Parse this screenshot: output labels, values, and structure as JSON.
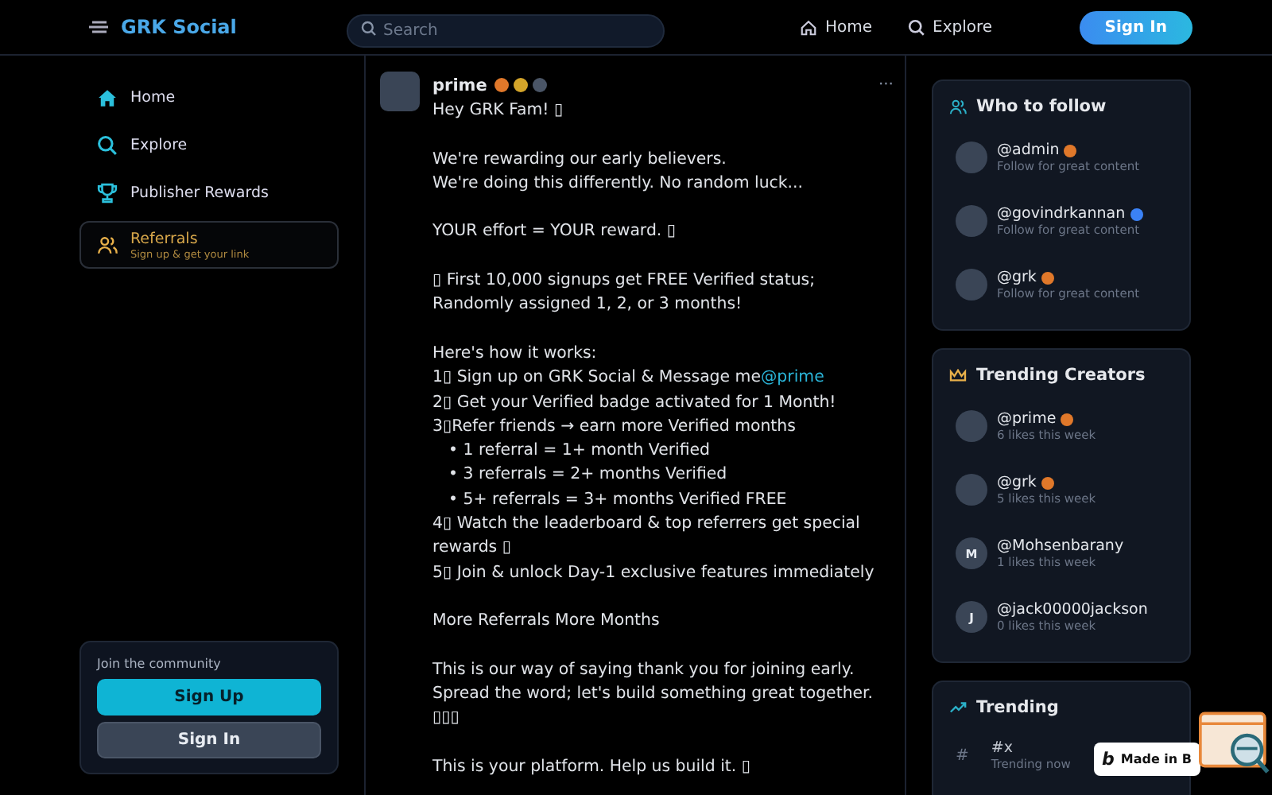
{
  "header": {
    "brand": "GRK Social",
    "search": {
      "placeholder": "Search"
    },
    "nav": [
      {
        "label": "Home"
      },
      {
        "label": "Explore"
      }
    ],
    "sign_in": "Sign In"
  },
  "sidebar": {
    "items": [
      {
        "label": "Home",
        "selected": false
      },
      {
        "label": "Explore",
        "selected": false
      },
      {
        "label": "Publisher Rewards",
        "selected": false
      },
      {
        "label": "Referrals",
        "sublabel": "Sign up & get your link",
        "selected": true
      }
    ],
    "community": {
      "label": "Join the community",
      "sign_up": "Sign Up",
      "sign_in": "Sign In"
    }
  },
  "post": {
    "author": "prime",
    "badges": [
      {
        "color": "#e0782a"
      },
      {
        "color": "#d4a52a"
      },
      {
        "color": "#4a5566"
      }
    ],
    "menu": "···",
    "paragraphs": [
      [
        {
          "kind": "text",
          "text": "Hey GRK Fam! ▯"
        }
      ],
      [
        {
          "kind": "text",
          "text": "We're rewarding our early believers."
        },
        {
          "kind": "text",
          "text": "We're doing this differently. No random luck..."
        }
      ],
      [
        {
          "kind": "text",
          "text": "YOUR effort = YOUR reward. ▯"
        }
      ],
      [
        {
          "kind": "text",
          "text": "▯ First 10,000 signups get FREE Verified status; Randomly assigned 1, 2, or 3 months!"
        }
      ],
      [
        {
          "kind": "text",
          "text": "Here's how it works:"
        },
        {
          "kind": "text",
          "text": "1▯ Sign up on GRK Social & Message me",
          "mention": "@prime"
        },
        {
          "kind": "text",
          "text": "2▯ Get your Verified badge activated for 1 Month!"
        },
        {
          "kind": "text",
          "text": "3▯Refer friends → earn more Verified months"
        },
        {
          "kind": "bullet",
          "marker": "•",
          "text": "1 referral = 1+ month Verified"
        },
        {
          "kind": "bullet",
          "marker": "•",
          "text": "3 referrals = 2+ months Verified"
        },
        {
          "kind": "bullet",
          "marker": "•",
          "text": "5+ referrals = 3+ months Verified FREE"
        },
        {
          "kind": "text",
          "text": "4▯ Watch the leaderboard & top referrers get special rewards ▯"
        },
        {
          "kind": "text",
          "text": "5▯ Join & unlock Day-1 exclusive features immediately"
        }
      ],
      [
        {
          "kind": "text",
          "text": "More Referrals More Months"
        }
      ],
      [
        {
          "kind": "text",
          "text": "This is our way of saying thank you for joining early. Spread the word; let's build something great together. ▯▯▯"
        }
      ],
      [
        {
          "kind": "text",
          "text": "This is your platform. Help us build it. ▯"
        }
      ]
    ]
  },
  "who_to_follow": {
    "title": "Who to follow",
    "users": [
      {
        "handle": "@admin",
        "note": "Follow for great content",
        "color": "#e0782a"
      },
      {
        "handle": "@govindrkannan",
        "note": "Follow for great content",
        "color": "#3b82f6"
      },
      {
        "handle": "@grk",
        "note": "Follow for great content",
        "color": "#e0782a"
      }
    ]
  },
  "trending_creators": {
    "title": "Trending Creators",
    "users": [
      {
        "handle": "@prime",
        "note": "6 likes this week",
        "color": "#e0782a"
      },
      {
        "handle": "@grk",
        "note": "5 likes this week",
        "color": "#e0782a"
      },
      {
        "handle": "@Mohsenbarany",
        "note": "1 likes this week",
        "initial": "M"
      },
      {
        "handle": "@jack00000jackson",
        "note": "0 likes this week",
        "initial": "J"
      }
    ]
  },
  "trending": {
    "title": "Trending",
    "topics": [
      {
        "mark": "#",
        "tag": "#x",
        "note": "Trending now"
      }
    ]
  },
  "made_in_badge": {
    "logo": "b",
    "text": "Made in B"
  }
}
